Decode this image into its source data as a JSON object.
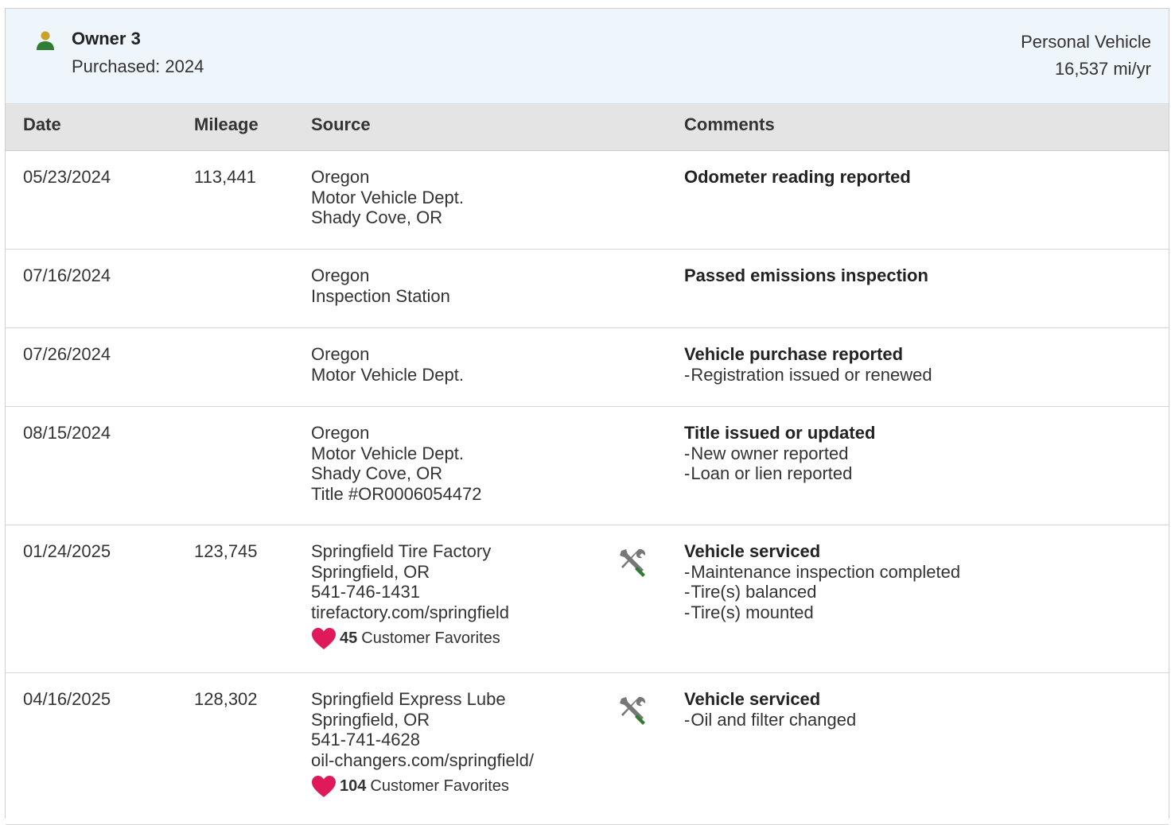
{
  "owner": {
    "title": "Owner 3",
    "purchased": "Purchased: 2024",
    "vehicle_type": "Personal Vehicle",
    "mileage_per_year": "16,537 mi/yr",
    "icon": "person-icon"
  },
  "columns": [
    "Date",
    "Mileage",
    "Source",
    "Comments"
  ],
  "colors": {
    "header_bg": "#eef5fb",
    "table_head_bg": "#e4e4e4",
    "person_head": "#c9a227",
    "person_body": "#2e7d32",
    "heart": "#e0195a",
    "wrench": "#777777",
    "screwdriver_handle": "#2e7d32"
  },
  "rows": [
    {
      "date": "05/23/2024",
      "mileage": "113,441",
      "source": [
        "Oregon",
        "Motor Vehicle Dept.",
        "Shady Cove, OR"
      ],
      "comment_title": "Odometer reading reported",
      "comment_items": []
    },
    {
      "date": "07/16/2024",
      "mileage": "",
      "source": [
        "Oregon",
        "Inspection Station"
      ],
      "comment_title": "Passed emissions inspection",
      "comment_items": []
    },
    {
      "date": "07/26/2024",
      "mileage": "",
      "source": [
        "Oregon",
        "Motor Vehicle Dept."
      ],
      "comment_title": "Vehicle purchase reported",
      "comment_items": [
        "Registration issued or renewed"
      ]
    },
    {
      "date": "08/15/2024",
      "mileage": "",
      "source": [
        "Oregon",
        "Motor Vehicle Dept.",
        "Shady Cove, OR",
        "Title #OR0006054472"
      ],
      "comment_title": "Title issued or updated",
      "comment_items": [
        "New owner reported",
        "Loan or lien reported"
      ]
    },
    {
      "date": "01/24/2025",
      "mileage": "123,745",
      "source": [
        "Springfield Tire Factory",
        "Springfield, OR",
        "541-746-1431",
        "tirefactory.com/springfield"
      ],
      "favorites_count": "45",
      "favorites_label": "Customer Favorites",
      "service_icon": "service-tools-icon",
      "comment_title": "Vehicle serviced",
      "comment_items": [
        "Maintenance inspection completed",
        "Tire(s) balanced",
        "Tire(s) mounted"
      ]
    },
    {
      "date": "04/16/2025",
      "mileage": "128,302",
      "source": [
        "Springfield Express Lube",
        "Springfield, OR",
        "541-741-4628",
        "oil-changers.com/springfield/"
      ],
      "favorites_count": "104",
      "favorites_label": "Customer Favorites",
      "service_icon": "service-tools-icon",
      "comment_title": "Vehicle serviced",
      "comment_items": [
        "Oil and filter changed"
      ]
    }
  ]
}
